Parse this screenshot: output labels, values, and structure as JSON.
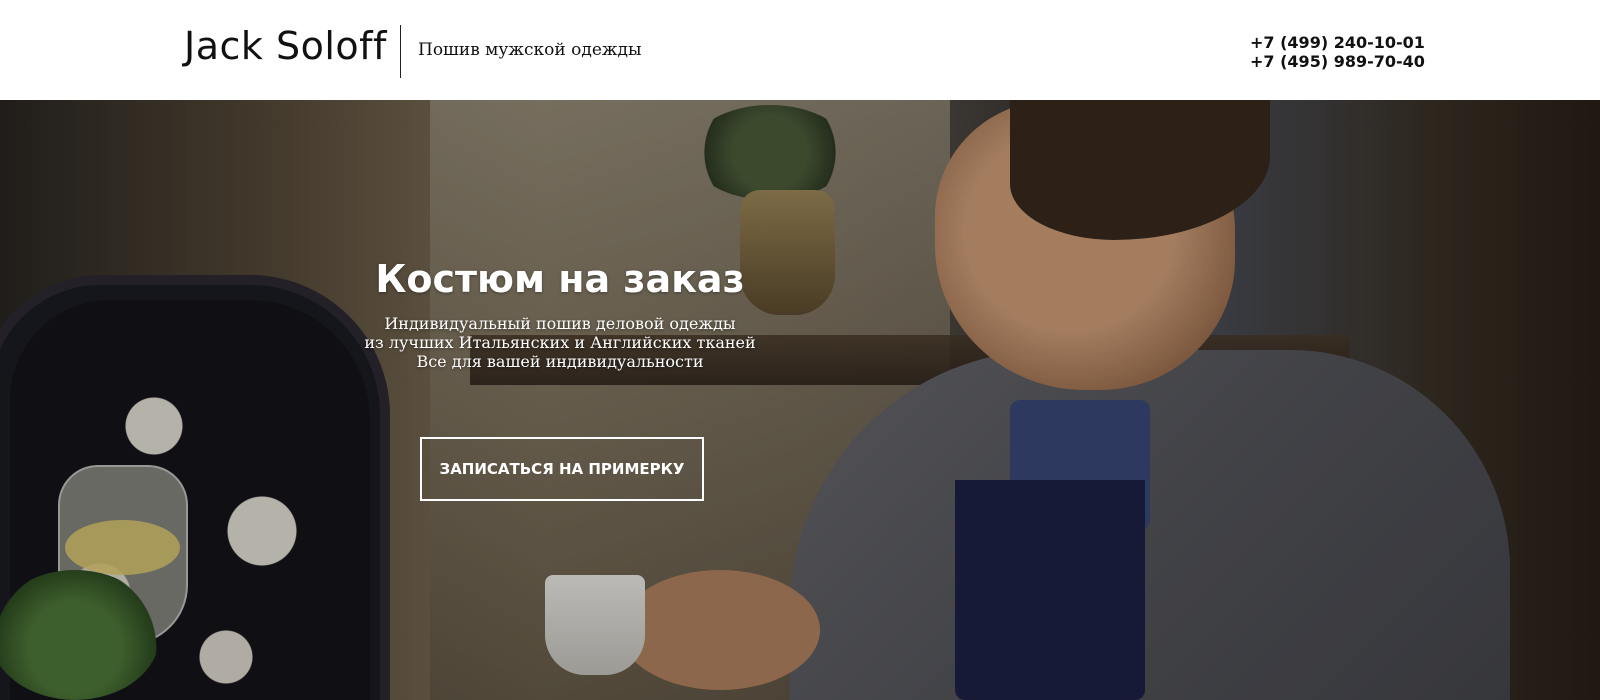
{
  "header": {
    "logo": "Jack Soloff",
    "tagline": "Пошив мужской одежды",
    "phones": [
      "+7 (499) 240-10-01",
      "+7 (495) 989-70-40"
    ]
  },
  "hero": {
    "title": "Костюм на заказ",
    "subtitle_lines": [
      "Индивидуальный пошив деловой одежды",
      "из лучших Итальянских и Английских тканей",
      "Все для вашей индивидуальности"
    ],
    "cta_label": "ЗАПИСАТЬСЯ НА ПРИМЕРКУ",
    "image_subject": "smiling-man-in-suit-photo"
  }
}
